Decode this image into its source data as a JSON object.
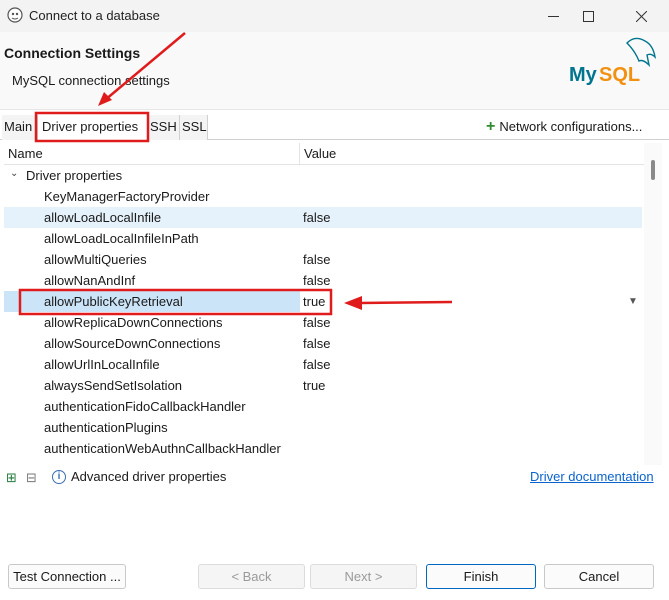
{
  "window": {
    "title": "Connect to a database",
    "icons": {
      "app": "dbeaver-icon",
      "minimize": "minimize-icon",
      "maximize": "maximize-icon",
      "close": "close-icon"
    }
  },
  "header": {
    "title": "Connection Settings",
    "subtitle": "MySQL connection settings",
    "logo_text": "MySQL",
    "logo_colors": {
      "my": "#00758f",
      "sql": "#f29111"
    }
  },
  "tabs": [
    {
      "label": "Main",
      "active": false
    },
    {
      "label": "Driver properties",
      "active": true
    },
    {
      "label": "SSH",
      "active": false
    },
    {
      "label": "SSL",
      "active": false
    }
  ],
  "network_config": {
    "label": "Network configurations...",
    "icon": "plus-icon"
  },
  "table": {
    "columns": [
      "Name",
      "Value"
    ],
    "group": "Driver properties",
    "rows": [
      {
        "name": "KeyManagerFactoryProvider",
        "value": ""
      },
      {
        "name": "allowLoadLocalInfile",
        "value": "false"
      },
      {
        "name": "allowLoadLocalInfileInPath",
        "value": ""
      },
      {
        "name": "allowMultiQueries",
        "value": "false"
      },
      {
        "name": "allowNanAndInf",
        "value": "false"
      },
      {
        "name": "allowPublicKeyRetrieval",
        "value": "true"
      },
      {
        "name": "allowReplicaDownConnections",
        "value": "false"
      },
      {
        "name": "allowSourceDownConnections",
        "value": "false"
      },
      {
        "name": "allowUrlInLocalInfile",
        "value": "false"
      },
      {
        "name": "alwaysSendSetIsolation",
        "value": "true"
      },
      {
        "name": "authenticationFidoCallbackHandler",
        "value": ""
      },
      {
        "name": "authenticationPlugins",
        "value": ""
      },
      {
        "name": "authenticationWebAuthnCallbackHandler",
        "value": ""
      }
    ]
  },
  "table_bar": {
    "advanced_label": "Advanced driver properties",
    "doc_link": "Driver documentation"
  },
  "footer": {
    "test_connection": "Test Connection ...",
    "back": "< Back",
    "next": "Next >",
    "finish": "Finish",
    "cancel": "Cancel"
  },
  "annotation_color": "#e01b1b"
}
